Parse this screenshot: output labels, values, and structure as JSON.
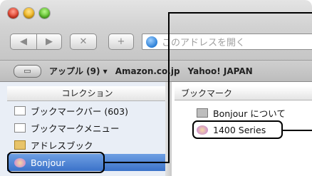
{
  "toolbar": {
    "back_label": "◀",
    "forward_label": "▶",
    "stop_label": "✕",
    "add_label": "+",
    "address_placeholder": "このアドレスを開く"
  },
  "bookmarks_bar": {
    "items": [
      "アップル (9) ▾",
      "Amazon.co.jp",
      "Yahoo! JAPAN"
    ]
  },
  "collections": {
    "header": "コレクション",
    "items": [
      {
        "label": "ブックマークバー (603)",
        "icon": "bookmarks-bar-icon"
      },
      {
        "label": "ブックマークメニュー",
        "icon": "bookmarks-menu-icon"
      },
      {
        "label": "アドレスブック",
        "icon": "address-book-icon"
      },
      {
        "label": "Bonjour",
        "icon": "bonjour-icon",
        "selected": true
      }
    ]
  },
  "bookmarks": {
    "header": "ブックマーク",
    "items": [
      {
        "label": "Bonjour について",
        "icon": "about-icon"
      },
      {
        "label": "1400 Series",
        "icon": "bonjour-icon"
      }
    ]
  },
  "colors": {
    "selection": "#3b72c9",
    "collection_bg": "#e9eef6"
  }
}
